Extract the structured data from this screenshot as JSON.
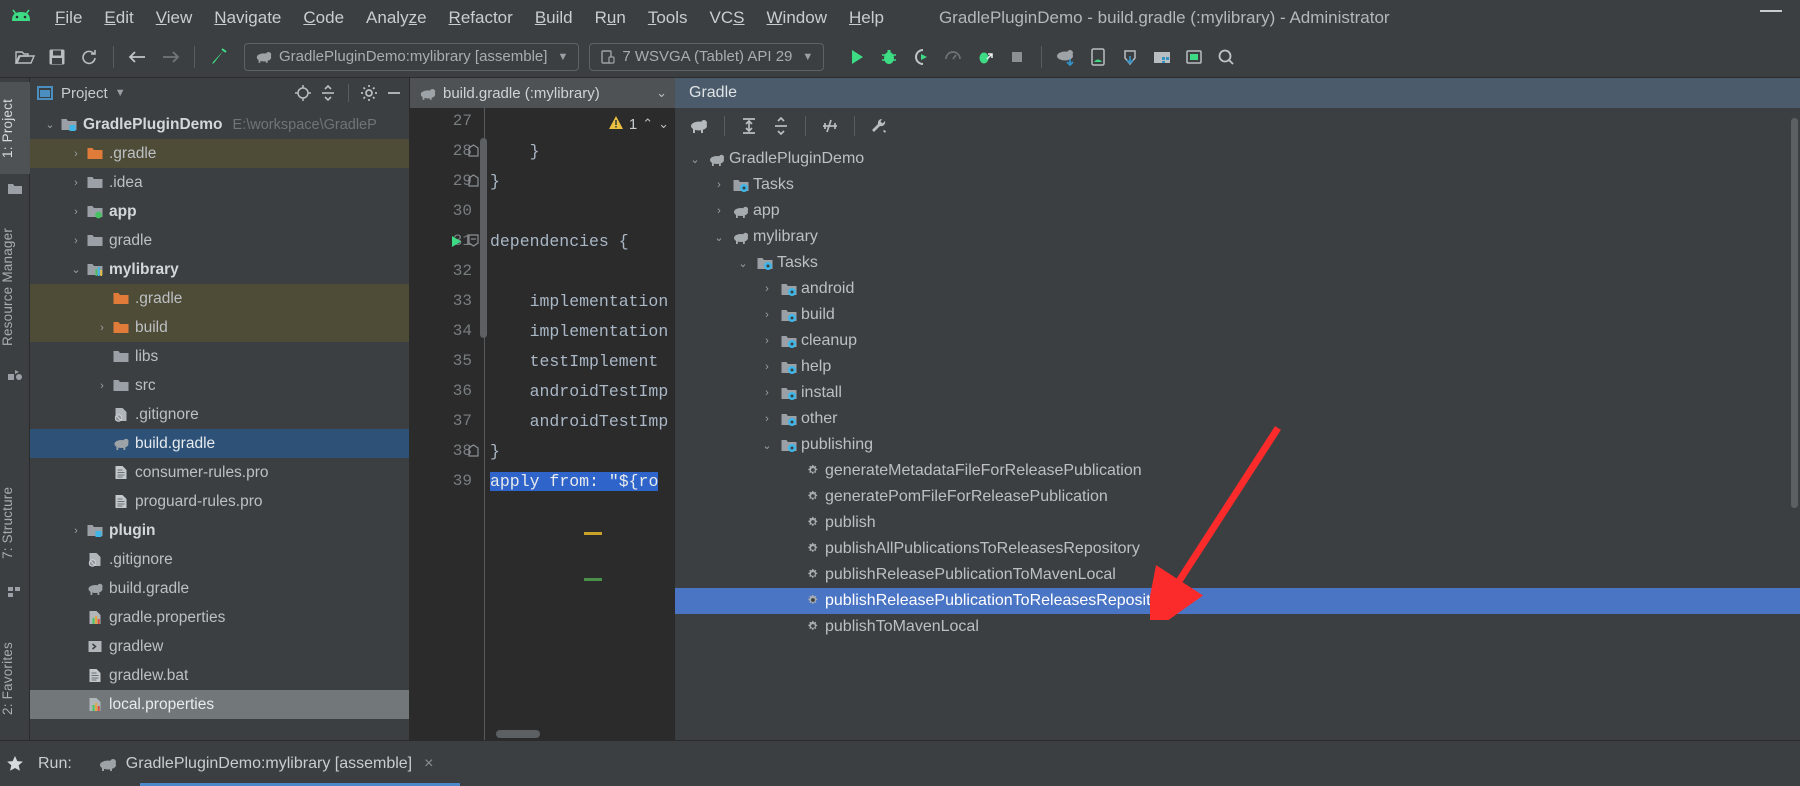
{
  "window": {
    "title": "GradlePluginDemo - build.gradle (:mylibrary) - Administrator",
    "minimize_label": "Minimize",
    "logo_name": "android-studio-logo"
  },
  "menubar": [
    {
      "label": "File",
      "mnemonic": "F"
    },
    {
      "label": "Edit",
      "mnemonic": "E"
    },
    {
      "label": "View",
      "mnemonic": "V"
    },
    {
      "label": "Navigate",
      "mnemonic": "N"
    },
    {
      "label": "Code",
      "mnemonic": "C"
    },
    {
      "label": "Analyze",
      "mnemonic": "z"
    },
    {
      "label": "Refactor",
      "mnemonic": "R"
    },
    {
      "label": "Build",
      "mnemonic": "B"
    },
    {
      "label": "Run",
      "mnemonic": "u"
    },
    {
      "label": "Tools",
      "mnemonic": "T"
    },
    {
      "label": "VCS",
      "mnemonic": "S"
    },
    {
      "label": "Window",
      "mnemonic": "W"
    },
    {
      "label": "Help",
      "mnemonic": "H"
    }
  ],
  "toolbar": {
    "icons_left": [
      "open-folder-icon",
      "save-all-icon",
      "sync-project-icon"
    ],
    "nav_icons": [
      "back-arrow-icon",
      "forward-arrow-icon"
    ],
    "build_icon": "build-hammer-icon",
    "run_config": "GradlePluginDemo:mylibrary [assemble]",
    "device_selector": "7 WSVGA (Tablet) API 29",
    "action_icons": [
      "run-icon",
      "debug-icon",
      "run-coverage-icon",
      "profiler-icon",
      "attach-debugger-icon",
      "stop-icon"
    ],
    "right_icons": [
      "sync-gradle-icon",
      "avd-manager-icon",
      "sdk-manager-icon",
      "project-structure-icon",
      "layout-inspector-icon",
      "search-everywhere-icon"
    ]
  },
  "left_tabs": [
    {
      "label": "1: Project",
      "mnemonic": "1",
      "active": true,
      "icon": "project-folder-icon"
    },
    {
      "label": "Resource Manager",
      "active": false,
      "icon": "resource-manager-icon"
    },
    {
      "label": "7: Structure",
      "mnemonic": "7",
      "active": false,
      "icon": "structure-icon"
    },
    {
      "label": "2: Favorites",
      "mnemonic": "2",
      "active": false,
      "icon": "favorites-star-icon"
    }
  ],
  "project_panel": {
    "title": "Project",
    "toolbar_icons": [
      "locate-icon",
      "collapse-all-icon",
      "settings-gear-icon",
      "hide-icon"
    ],
    "tree": [
      {
        "label": "GradlePluginDemo",
        "path": "E:\\workspace\\GradleP",
        "indent": 0,
        "arrow": "down",
        "icon": "module-icon",
        "bold": true,
        "state": "normal"
      },
      {
        "label": ".gradle",
        "indent": 1,
        "arrow": "right",
        "icon": "folder-orange-icon",
        "bold": false,
        "state": "highlight"
      },
      {
        "label": ".idea",
        "indent": 1,
        "arrow": "right",
        "icon": "folder-grey-icon",
        "bold": false,
        "state": "normal"
      },
      {
        "label": "app",
        "indent": 1,
        "arrow": "right",
        "icon": "module-green-icon",
        "bold": true,
        "state": "normal"
      },
      {
        "label": "gradle",
        "indent": 1,
        "arrow": "right",
        "icon": "folder-grey-icon",
        "bold": false,
        "state": "normal"
      },
      {
        "label": "mylibrary",
        "indent": 1,
        "arrow": "down",
        "icon": "library-module-icon",
        "bold": true,
        "state": "normal"
      },
      {
        "label": ".gradle",
        "indent": 2,
        "arrow": "none",
        "icon": "folder-orange-icon",
        "bold": false,
        "state": "highlight"
      },
      {
        "label": "build",
        "indent": 2,
        "arrow": "right",
        "icon": "folder-orange-icon",
        "bold": false,
        "state": "highlight"
      },
      {
        "label": "libs",
        "indent": 2,
        "arrow": "none",
        "icon": "folder-grey-icon",
        "bold": false,
        "state": "normal"
      },
      {
        "label": "src",
        "indent": 2,
        "arrow": "right",
        "icon": "folder-grey-icon",
        "bold": false,
        "state": "normal"
      },
      {
        "label": ".gitignore",
        "indent": 2,
        "arrow": "none",
        "icon": "gitignore-file-icon",
        "bold": false,
        "state": "normal"
      },
      {
        "label": "build.gradle",
        "indent": 2,
        "arrow": "none",
        "icon": "gradle-file-icon",
        "bold": false,
        "state": "selected"
      },
      {
        "label": "consumer-rules.pro",
        "indent": 2,
        "arrow": "none",
        "icon": "text-file-icon",
        "bold": false,
        "state": "normal"
      },
      {
        "label": "proguard-rules.pro",
        "indent": 2,
        "arrow": "none",
        "icon": "text-file-icon",
        "bold": false,
        "state": "normal"
      },
      {
        "label": "plugin",
        "indent": 1,
        "arrow": "right",
        "icon": "module-icon",
        "bold": true,
        "state": "normal"
      },
      {
        "label": ".gitignore",
        "indent": 1,
        "arrow": "none",
        "icon": "gitignore-file-icon",
        "bold": false,
        "state": "normal"
      },
      {
        "label": "build.gradle",
        "indent": 1,
        "arrow": "none",
        "icon": "gradle-file-icon",
        "bold": false,
        "state": "normal"
      },
      {
        "label": "gradle.properties",
        "indent": 1,
        "arrow": "none",
        "icon": "properties-file-icon",
        "bold": false,
        "state": "normal"
      },
      {
        "label": "gradlew",
        "indent": 1,
        "arrow": "none",
        "icon": "script-file-icon",
        "bold": false,
        "state": "normal"
      },
      {
        "label": "gradlew.bat",
        "indent": 1,
        "arrow": "none",
        "icon": "text-file-icon",
        "bold": false,
        "state": "normal"
      },
      {
        "label": "local.properties",
        "indent": 1,
        "arrow": "none",
        "icon": "properties-file-icon",
        "bold": false,
        "state": "selected-inactive"
      }
    ]
  },
  "editor": {
    "tab_label": "build.gradle (:mylibrary)",
    "tab_icon": "gradle-file-icon",
    "warning_count": "1",
    "warning_icon": "warning-triangle-icon",
    "lines": [
      {
        "num": "27",
        "text": "",
        "fold": "",
        "run": false
      },
      {
        "num": "28",
        "text": "    }",
        "fold": "end",
        "run": false
      },
      {
        "num": "29",
        "text": "}",
        "fold": "end",
        "run": false
      },
      {
        "num": "30",
        "text": "",
        "fold": "",
        "run": false
      },
      {
        "num": "31",
        "text": "dependencies {",
        "fold": "start",
        "run": true
      },
      {
        "num": "32",
        "text": "",
        "fold": "",
        "run": false
      },
      {
        "num": "33",
        "text": "    implementation",
        "fold": "",
        "run": false
      },
      {
        "num": "34",
        "text": "    implementation",
        "fold": "",
        "run": false
      },
      {
        "num": "35",
        "text": "    testImplement",
        "fold": "",
        "run": false
      },
      {
        "num": "36",
        "text": "    androidTestImp",
        "fold": "",
        "run": false
      },
      {
        "num": "37",
        "text": "    androidTestImp",
        "fold": "",
        "run": false
      },
      {
        "num": "38",
        "text": "}",
        "fold": "end",
        "run": false
      },
      {
        "num": "39",
        "text": "apply from: \"${ro",
        "fold": "",
        "run": false,
        "selected": true
      }
    ],
    "selected_line_parts": [
      {
        "t": "apply",
        "cls": "kw"
      },
      {
        "t": " from",
        "cls": "fn"
      },
      {
        "t": ": \"${ro",
        "cls": "plain"
      }
    ]
  },
  "gradle_panel": {
    "title": "Gradle",
    "toolbar_icons": [
      "execute-gradle-task-icon",
      "expand-all-icon",
      "collapse-all-icon",
      "toggle-offline-icon",
      "gradle-settings-wrench-icon"
    ],
    "tree": [
      {
        "label": "GradlePluginDemo",
        "indent": 0,
        "arrow": "down",
        "icon": "gradle-elephant-icon",
        "selected": false
      },
      {
        "label": "Tasks",
        "indent": 1,
        "arrow": "right",
        "icon": "tasks-folder-icon",
        "selected": false
      },
      {
        "label": "app",
        "indent": 1,
        "arrow": "right",
        "icon": "gradle-elephant-icon",
        "selected": false
      },
      {
        "label": "mylibrary",
        "indent": 1,
        "arrow": "down",
        "icon": "gradle-elephant-icon",
        "selected": false
      },
      {
        "label": "Tasks",
        "indent": 2,
        "arrow": "down",
        "icon": "tasks-folder-icon",
        "selected": false
      },
      {
        "label": "android",
        "indent": 3,
        "arrow": "right",
        "icon": "tasks-folder-icon",
        "selected": false
      },
      {
        "label": "build",
        "indent": 3,
        "arrow": "right",
        "icon": "tasks-folder-icon",
        "selected": false
      },
      {
        "label": "cleanup",
        "indent": 3,
        "arrow": "right",
        "icon": "tasks-folder-icon",
        "selected": false
      },
      {
        "label": "help",
        "indent": 3,
        "arrow": "right",
        "icon": "tasks-folder-icon",
        "selected": false
      },
      {
        "label": "install",
        "indent": 3,
        "arrow": "right",
        "icon": "tasks-folder-icon",
        "selected": false
      },
      {
        "label": "other",
        "indent": 3,
        "arrow": "right",
        "icon": "tasks-folder-icon",
        "selected": false
      },
      {
        "label": "publishing",
        "indent": 3,
        "arrow": "down",
        "icon": "tasks-folder-icon",
        "selected": false
      },
      {
        "label": "generateMetadataFileForReleasePublication",
        "indent": 4,
        "arrow": "none",
        "icon": "gradle-task-gear-icon",
        "selected": false
      },
      {
        "label": "generatePomFileForReleasePublication",
        "indent": 4,
        "arrow": "none",
        "icon": "gradle-task-gear-icon",
        "selected": false
      },
      {
        "label": "publish",
        "indent": 4,
        "arrow": "none",
        "icon": "gradle-task-gear-icon",
        "selected": false
      },
      {
        "label": "publishAllPublicationsToReleasesRepository",
        "indent": 4,
        "arrow": "none",
        "icon": "gradle-task-gear-icon",
        "selected": false
      },
      {
        "label": "publishReleasePublicationToMavenLocal",
        "indent": 4,
        "arrow": "none",
        "icon": "gradle-task-gear-icon",
        "selected": false
      },
      {
        "label": "publishReleasePublicationToReleasesRepository",
        "indent": 4,
        "arrow": "none",
        "icon": "gradle-task-gear-icon",
        "selected": true
      },
      {
        "label": "publishToMavenLocal",
        "indent": 4,
        "arrow": "none",
        "icon": "gradle-task-gear-icon",
        "selected": false
      }
    ]
  },
  "bottom_bar": {
    "star_icon": "favorites-star-icon",
    "run_label": "Run:",
    "config_icon": "gradle-file-icon",
    "config_label": "GradlePluginDemo:mylibrary [assemble]",
    "close_label": "×"
  },
  "annotation": {
    "arrow_color": "#fc2b2b",
    "arrow_name": "red-pointer-arrow"
  },
  "colors": {
    "accent_blue": "#4a74c4",
    "panel_bg": "#3c3f41",
    "editor_bg": "#2b2b2b",
    "selection_blue": "#2d5177",
    "highlight_olive": "#4e4b36",
    "green": "#4caf50",
    "warning_yellow": "#e8bf3f"
  }
}
